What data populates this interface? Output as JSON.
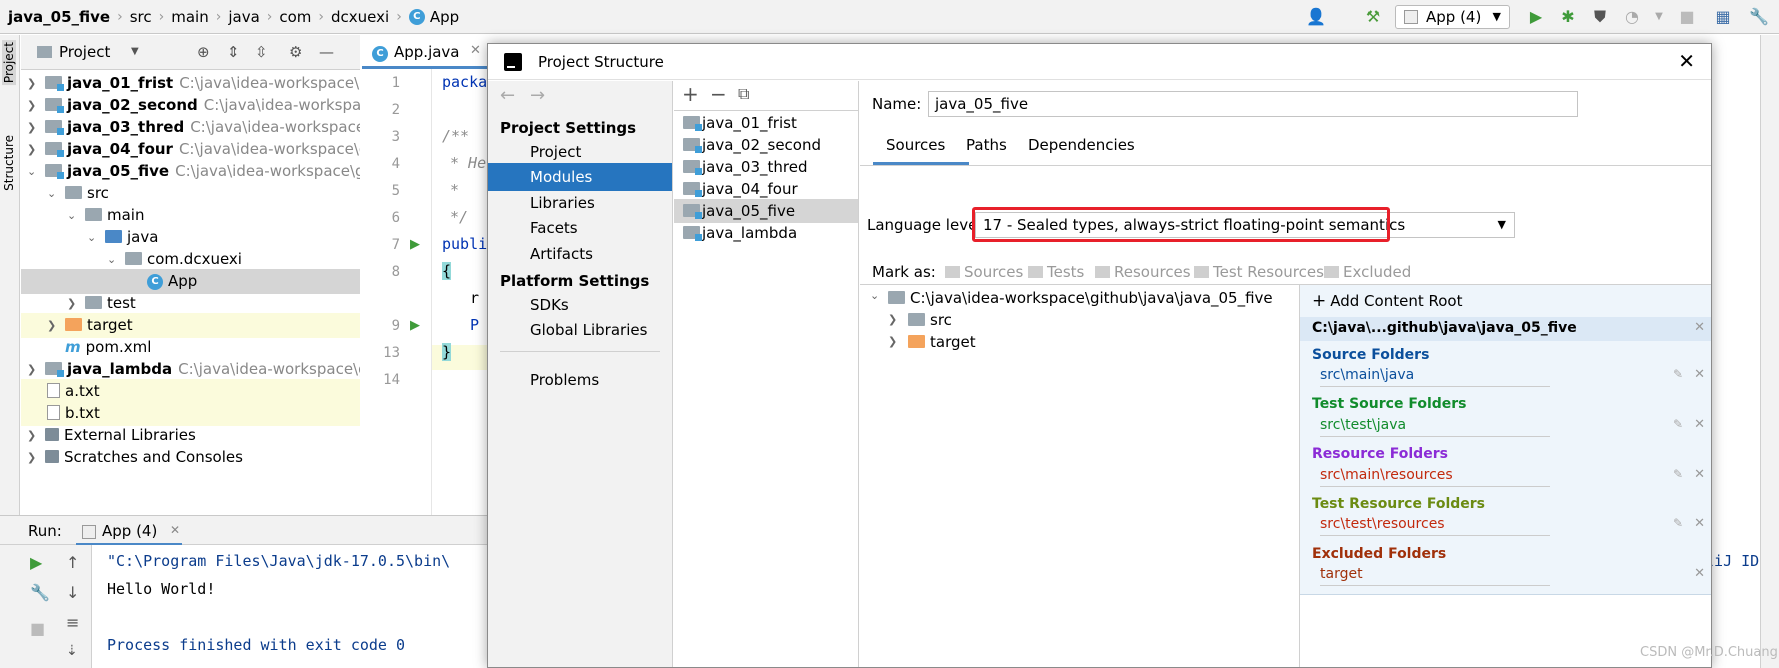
{
  "breadcrumb": {
    "project": "java_05_five",
    "items": [
      "src",
      "main",
      "java",
      "com",
      "dcxuexi"
    ],
    "file": "App"
  },
  "toolbar": {
    "run_config": "App (4)"
  },
  "left_strip": {
    "project_label": "Project",
    "structure_label": "Structure"
  },
  "project_panel": {
    "title": "Project",
    "rows": [
      {
        "name": "java_01_frist",
        "path": "C:\\java\\idea-workspace\\g"
      },
      {
        "name": "java_02_second",
        "path": "C:\\java\\idea-workspac"
      },
      {
        "name": "java_03_thred",
        "path": "C:\\java\\idea-workspace\\"
      },
      {
        "name": "java_04_four",
        "path": "C:\\java\\idea-workspace\\g"
      },
      {
        "name": "java_05_five",
        "path": "C:\\java\\idea-workspace\\gi"
      },
      {
        "name": "src"
      },
      {
        "name": "main"
      },
      {
        "name": "java"
      },
      {
        "name": "com.dcxuexi"
      },
      {
        "name": "App"
      },
      {
        "name": "test"
      },
      {
        "name": "target"
      },
      {
        "name": "pom.xml"
      },
      {
        "name": "java_lambda",
        "path": "C:\\java\\idea-workspace\\g"
      },
      {
        "name": "a.txt"
      },
      {
        "name": "b.txt"
      },
      {
        "name": "External Libraries"
      },
      {
        "name": "Scratches and Consoles"
      }
    ]
  },
  "editor": {
    "tab": "App.java",
    "line_numbers": [
      "1",
      "2",
      "3",
      "4",
      "5",
      "6",
      "7",
      "8",
      "9",
      "13",
      "14"
    ],
    "code": [
      "packa",
      "/**",
      "* He",
      "*",
      "*/",
      "publi",
      "{",
      "r",
      "P",
      "}"
    ]
  },
  "run": {
    "label": "Run:",
    "tab": "App (4)",
    "lines": [
      "\"C:\\Program Files\\Java\\jdk-17.0.5\\bin\\",
      "Hello World!",
      "Process finished with exit code 0"
    ],
    "right_fragment": "lliJ IDE"
  },
  "dialog": {
    "title": "Project Structure",
    "nav": {
      "project_settings": "Project Settings",
      "project_items": [
        "Project",
        "Modules",
        "Libraries",
        "Facets",
        "Artifacts"
      ],
      "platform_settings": "Platform Settings",
      "platform_items": [
        "SDKs",
        "Global Libraries"
      ],
      "problems": "Problems"
    },
    "modules": [
      "java_01_frist",
      "java_02_second",
      "java_03_thred",
      "java_04_four",
      "java_05_five",
      "java_lambda"
    ],
    "name_label": "Name:",
    "name_value": "java_05_five",
    "tabs": [
      "Sources",
      "Paths",
      "Dependencies"
    ],
    "language_level_label": "Language level:",
    "language_level_value": "17 - Sealed types, always-strict floating-point semantics",
    "mark_as_label": "Mark as:",
    "mark_as": [
      "Sources",
      "Tests",
      "Resources",
      "Test Resources",
      "Excluded"
    ],
    "content_root": "C:\\java\\idea-workspace\\github\\java\\java_05_five",
    "root_children": [
      "src",
      "target"
    ],
    "add_content_root": "Add Content Root",
    "root_short": "C:\\java\\...github\\java\\java_05_five",
    "folders": [
      {
        "heading": "Source Folders",
        "value": "src\\main\\java",
        "heading_color": "#0b4f9c",
        "value_color": "#0b4f9c"
      },
      {
        "heading": "Test Source Folders",
        "value": "src\\test\\java",
        "heading_color": "#118c2c",
        "value_color": "#118c2c"
      },
      {
        "heading": "Resource Folders",
        "value": "src\\main\\resources",
        "heading_color": "#8b2bd6",
        "value_color": "#c2290d"
      },
      {
        "heading": "Test Resource Folders",
        "value": "src\\test\\resources",
        "heading_color": "#6b8b12",
        "value_color": "#c2290d"
      },
      {
        "heading": "Excluded Folders",
        "value": "target",
        "heading_color": "#a0300a",
        "value_color": "#a0300a"
      }
    ]
  },
  "watermark": "CSDN @Mr.D.Chuang",
  "colors": {
    "selection": "#2675bf",
    "highlight_box": "#e8202a",
    "tab_underline": "#4a88c7"
  }
}
